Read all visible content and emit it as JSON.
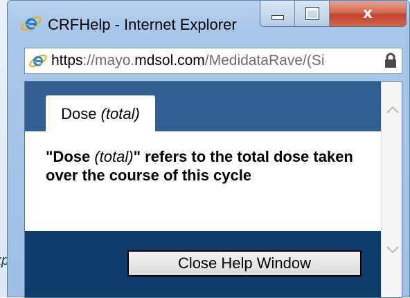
{
  "background": {
    "partial_text": "xp"
  },
  "window": {
    "title": "CRFHelp - Internet Explorer",
    "close_glyph": "x"
  },
  "address": {
    "url_prefix": "https",
    "url_mid": "://mayo.",
    "url_domain": "mdsol.com",
    "url_path": "/MedidataRave/(Si"
  },
  "help": {
    "tab_word": "Dose",
    "tab_qualifier": "(total)",
    "message_open": "\"Dose ",
    "message_qualifier": "(total)",
    "message_rest": "\" refers to the total dose taken over the course of this cycle",
    "close_button": "Close Help Window"
  },
  "colors": {
    "tab_band": "#315f91",
    "footer": "#103c6b",
    "close_button_bg": "#c2452b"
  },
  "icons": {
    "browser": "ie-icon",
    "page": "ie-icon",
    "security": "lock-icon",
    "scroll_up": "chevron-up-icon",
    "scroll_down": "chevron-down-icon"
  }
}
